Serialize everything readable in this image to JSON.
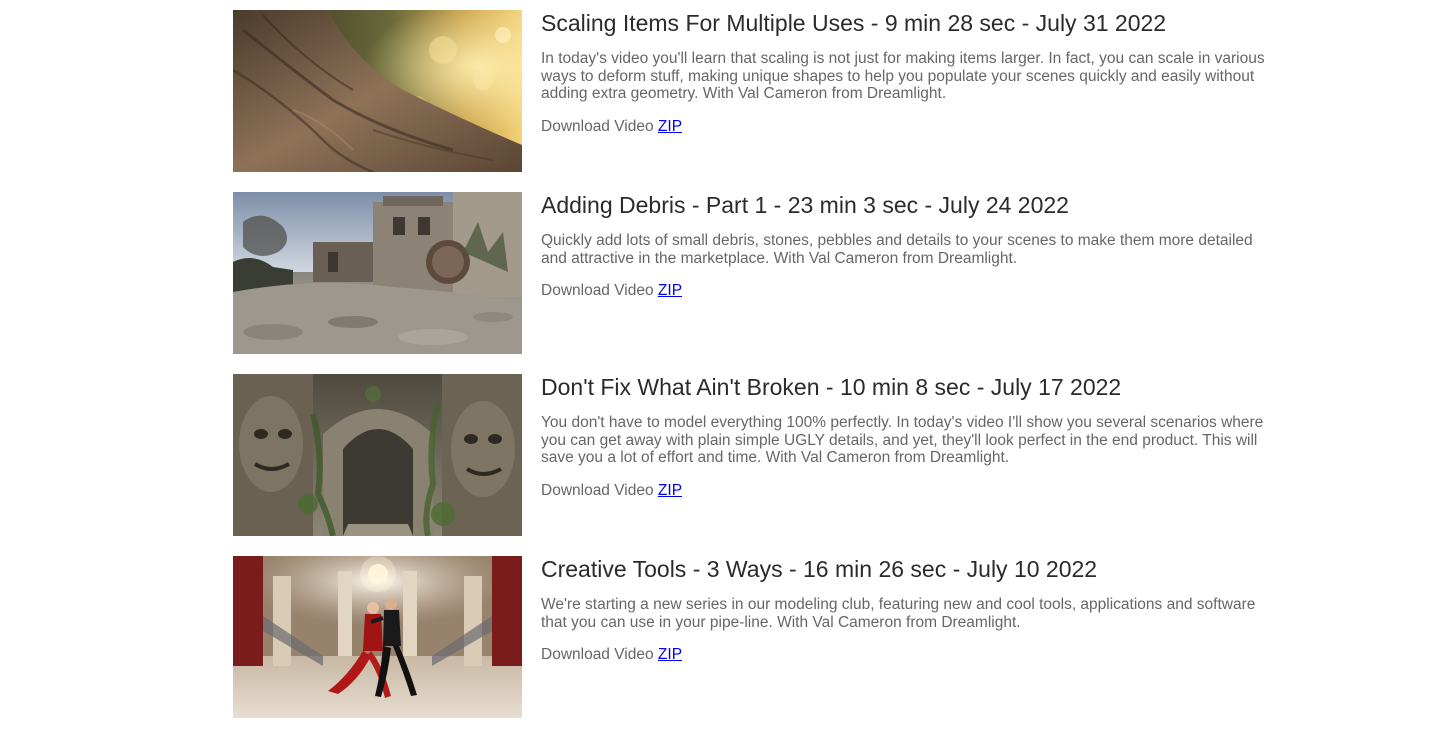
{
  "videos": [
    {
      "title": "Scaling Items For Multiple Uses - 9 min 28 sec - July 31 2022",
      "description": "In today's video you'll learn that scaling is not just for making items larger. In fact, you can scale in various ways to deform stuff, making unique shapes to help you populate your scenes quickly and easily without adding extra geometry. With Val Cameron from Dreamlight.",
      "download_label": "Download Video",
      "zip_label": "ZIP",
      "thumbnail": "tree-trunk-thumbnail"
    },
    {
      "title": "Adding Debris - Part 1 - 23 min 3 sec - July 24 2022",
      "description": "Quickly add lots of small debris, stones, pebbles and details to your scenes to make them more detailed and attractive in the marketplace. With Val Cameron from Dreamlight.",
      "download_label": "Download Video",
      "zip_label": "ZIP",
      "thumbnail": "stone-courtyard-thumbnail"
    },
    {
      "title": "Don't Fix What Ain't Broken - 10 min 8 sec - July 17 2022",
      "description": "You don't have to model everything 100% perfectly. In today's video I'll show you several scenarios where you can get away with plain simple UGLY details, and yet, they'll look perfect in the end product. This will save you a lot of effort and time. With Val Cameron from Dreamlight.",
      "download_label": "Download Video",
      "zip_label": "ZIP",
      "thumbnail": "stone-faces-archway-thumbnail"
    },
    {
      "title": "Creative Tools - 3 Ways - 16 min 26 sec - July 10 2022",
      "description": "We're starting a new series in our modeling club, featuring new and cool tools, applications and software that you can use in your pipe-line. With Val Cameron from Dreamlight.",
      "download_label": "Download Video",
      "zip_label": "ZIP",
      "thumbnail": "dancing-couple-ballroom-thumbnail"
    }
  ]
}
